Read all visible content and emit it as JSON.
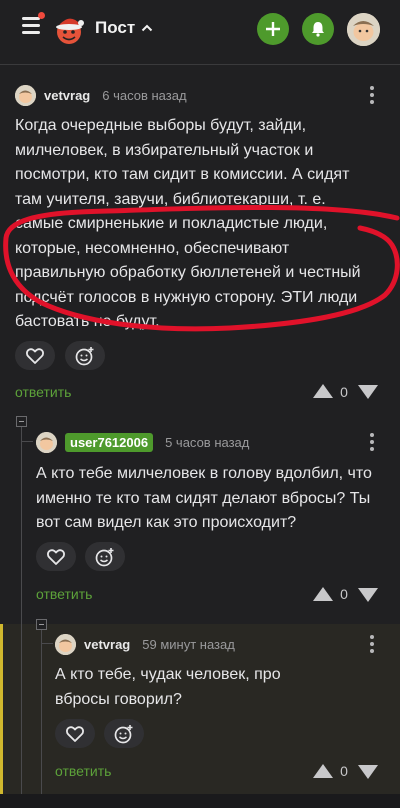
{
  "header": {
    "title": "Пост",
    "accent": "#4e9a2c"
  },
  "comments": [
    {
      "author": "vetvrag",
      "time": "6 часов назад",
      "lines": [
        "Когда очередные выборы будут, зайди,",
        "милчеловек, в избирательный участок и",
        "посмотри, кто там сидит в комиссии. А сидят",
        "там учителя, завучи, библиотекарши, т. е.",
        "самые смирненькие и покладистые люди,",
        "которые, несомненно, обеспечивают",
        "правильную обработку бюллетеней и честный",
        "подсчёт голосов в нужную сторону. ЭТИ люди",
        "бастовать не будут."
      ],
      "reply_label": "ответить",
      "votes": "0"
    },
    {
      "author": "user7612006",
      "time": "5 часов назад",
      "lines": [
        "А кто тебе милчеловек в голову вдолбил, что",
        "именно те кто там сидят делают вбросы? Ты",
        "вот сам видел как это происходит?"
      ],
      "reply_label": "ответить",
      "votes": "0"
    },
    {
      "author": "vetvrag",
      "time": "59 минут назад",
      "lines": [
        "А кто тебе, чудак человек, про",
        "вбросы говорил?"
      ],
      "reply_label": "ответить",
      "votes": "0"
    }
  ],
  "annotation_color": "#e0122a"
}
